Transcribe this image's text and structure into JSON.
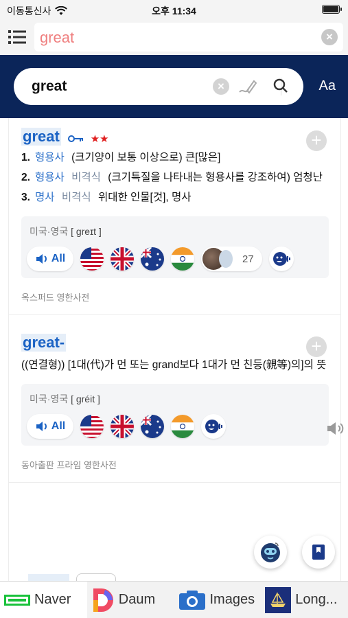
{
  "status_bar": {
    "carrier": "이동통신사",
    "time": "오후 11:34"
  },
  "top_search": {
    "query": "great"
  },
  "dict_search": {
    "query": "great",
    "font_button": "Aa"
  },
  "entries": [
    {
      "headword": "great",
      "stars": "★★",
      "senses": [
        {
          "num": "1.",
          "pos": "형용사",
          "tag": "",
          "text": "(크기양이 보통 이상으로) 큰[많은]"
        },
        {
          "num": "2.",
          "pos": "형용사",
          "tag": "비격식",
          "text": "(크기특질을 나타내는 형용사를 강조하여) 엄청난"
        },
        {
          "num": "3.",
          "pos": "명사",
          "tag": "비격식",
          "text": "위대한 인물[것], 명사"
        }
      ],
      "pron_label": "미국·영국",
      "ipa": "[ greɪt ]",
      "all_label": "All",
      "user_count": "27",
      "source": "옥스퍼드 영한사전"
    },
    {
      "headword": "great-",
      "gloss": "((연결형)) [1대(代)가 먼 또는 grand보다 1대가 먼 친등(親等)의]의 뜻",
      "pron_label": "미국·영국",
      "ipa": "[ gréit ]",
      "all_label": "All",
      "source": "동아출판 프라임 영한사전"
    }
  ],
  "bottom_tabs": [
    "Naver",
    "Daum",
    "Images",
    "Long..."
  ],
  "colors": {
    "accent": "#1a62c4",
    "band": "#0b2559",
    "query_pink": "#ef7f7f",
    "star": "#e02020"
  }
}
